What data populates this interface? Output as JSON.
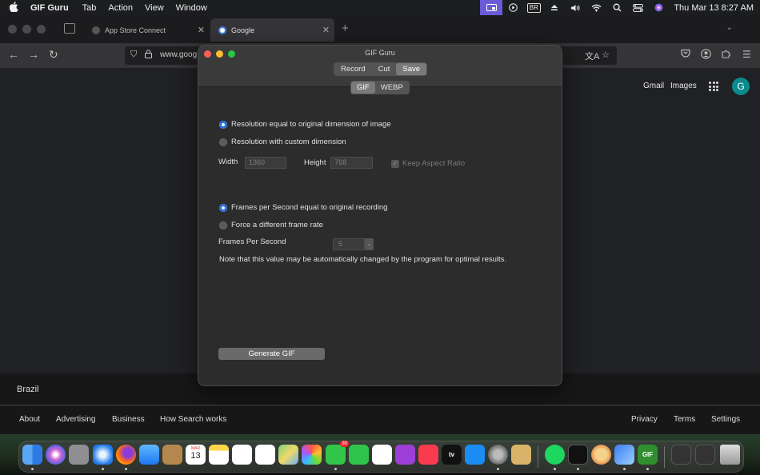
{
  "menubar": {
    "apple": "",
    "app_name": "GIF Guru",
    "menus": [
      "Tab",
      "Action",
      "View",
      "Window"
    ],
    "input_source": "BR",
    "clock": "Thu Mar 13  8:27 AM"
  },
  "browser": {
    "tabs": [
      {
        "label": "App Store Connect",
        "close": "✕"
      },
      {
        "label": "Google",
        "close": "✕"
      }
    ],
    "new_tab": "+",
    "url": "www.goog",
    "header_links": [
      "Gmail",
      "Images"
    ],
    "avatar_initial": "G",
    "country": "Brazil",
    "footer_left": [
      "About",
      "Advertising",
      "Business",
      "How Search works"
    ],
    "footer_right": [
      "Privacy",
      "Terms",
      "Settings"
    ]
  },
  "gifguru": {
    "title": "GIF Guru",
    "main_tabs": [
      "Record",
      "Cut",
      "Save"
    ],
    "main_selected": "Save",
    "format_tabs": [
      "GIF",
      "WEBP"
    ],
    "format_selected": "GIF",
    "resolution_original": "Resolution equal to original dimension of image",
    "resolution_custom": "Resolution with custom dimension",
    "width_label": "Width",
    "width_value": "1360",
    "height_label": "Height",
    "height_value": "768",
    "keep_aspect": "Keep Aspect Ratio",
    "fps_original": "Frames per Second equal to original recording",
    "fps_force": "Force a different frame rate",
    "fps_label": "Frames Per Second",
    "fps_value": "5",
    "note": "Note that this value may be automatically changed by the program for optimal results.",
    "generate_button": "Generate GIF"
  },
  "dock": {
    "calendar_month": "MAR",
    "calendar_day": "13",
    "tv_label": "tv",
    "gif_label": "GIF",
    "messages_badge": "30"
  },
  "colors": {
    "accent": "#2f6fe4",
    "menubar_active": "#6a5cd6",
    "google_avatar": "#0b8a8e"
  }
}
